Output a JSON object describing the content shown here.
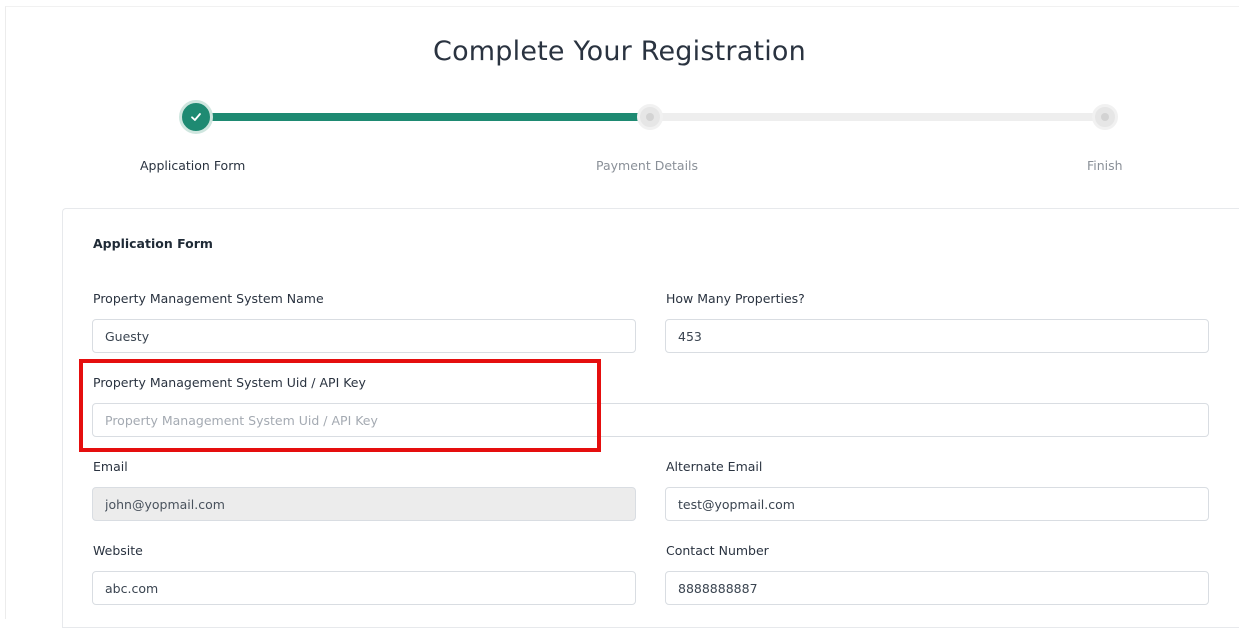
{
  "page_title": "Complete Your Registration",
  "stepper": {
    "steps": [
      {
        "label": "Application Form",
        "state": "completed"
      },
      {
        "label": "Payment Details",
        "state": "pending"
      },
      {
        "label": "Finish",
        "state": "pending"
      }
    ],
    "colors": {
      "accent": "#1e8a72",
      "inactive": "#eeeeee"
    }
  },
  "form": {
    "title": "Application Form",
    "fields": {
      "pms_name": {
        "label": "Property Management System Name",
        "value": "Guesty"
      },
      "properties": {
        "label": "How Many Properties?",
        "value": "453"
      },
      "api_key": {
        "label": "Property Management System Uid / API Key",
        "value": "",
        "placeholder": "Property Management System Uid / API Key"
      },
      "email": {
        "label": "Email",
        "value": "john@yopmail.com"
      },
      "alt_email": {
        "label": "Alternate Email",
        "value": "test@yopmail.com"
      },
      "website": {
        "label": "Website",
        "value": "abc.com"
      },
      "contact": {
        "label": "Contact Number",
        "value": "8888888887"
      }
    }
  },
  "annotation": {
    "color": "#e50e0e"
  }
}
